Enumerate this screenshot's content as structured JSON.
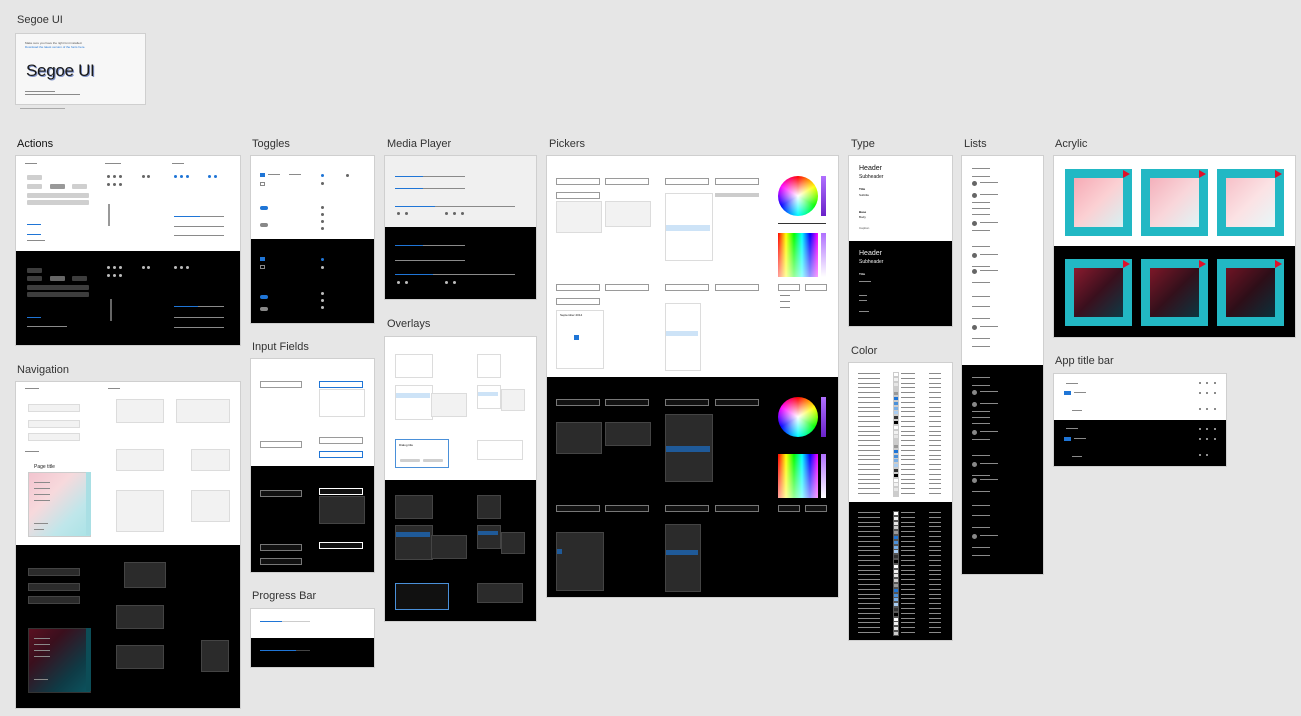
{
  "sections": {
    "segoe": "Segoe UI",
    "actions": "Actions",
    "navigation": "Navigation",
    "toggles": "Toggles",
    "input_fields": "Input Fields",
    "progress_bar": "Progress Bar",
    "media_player": "Media Player",
    "overlays": "Overlays",
    "pickers": "Pickers",
    "type": "Type",
    "color": "Color",
    "lists": "Lists",
    "acrylic": "Acrylic",
    "app_title_bar": "App title bar"
  },
  "segoe_card": {
    "note": "Make sure you have the right font installed.",
    "link": "Download the latest version of the fonts here.",
    "sample": "Segoe UI"
  },
  "type_card": {
    "header": "Header",
    "subheader": "Subheader",
    "title": "Title",
    "subtitle": "Subtitle",
    "base": "Base",
    "body": "Body",
    "caption": "Caption"
  },
  "nav_card": {
    "page_title": "Page title"
  },
  "picker_card": {
    "month": "September 2014"
  },
  "overlay_card": {
    "dialog_title": "Dialog title",
    "button_a": "Button",
    "button_b": "Button"
  },
  "colors": {
    "accent": "#1f75d6",
    "acrylic_teal": "#22b8c4",
    "cursor_red": "#e0102a"
  }
}
